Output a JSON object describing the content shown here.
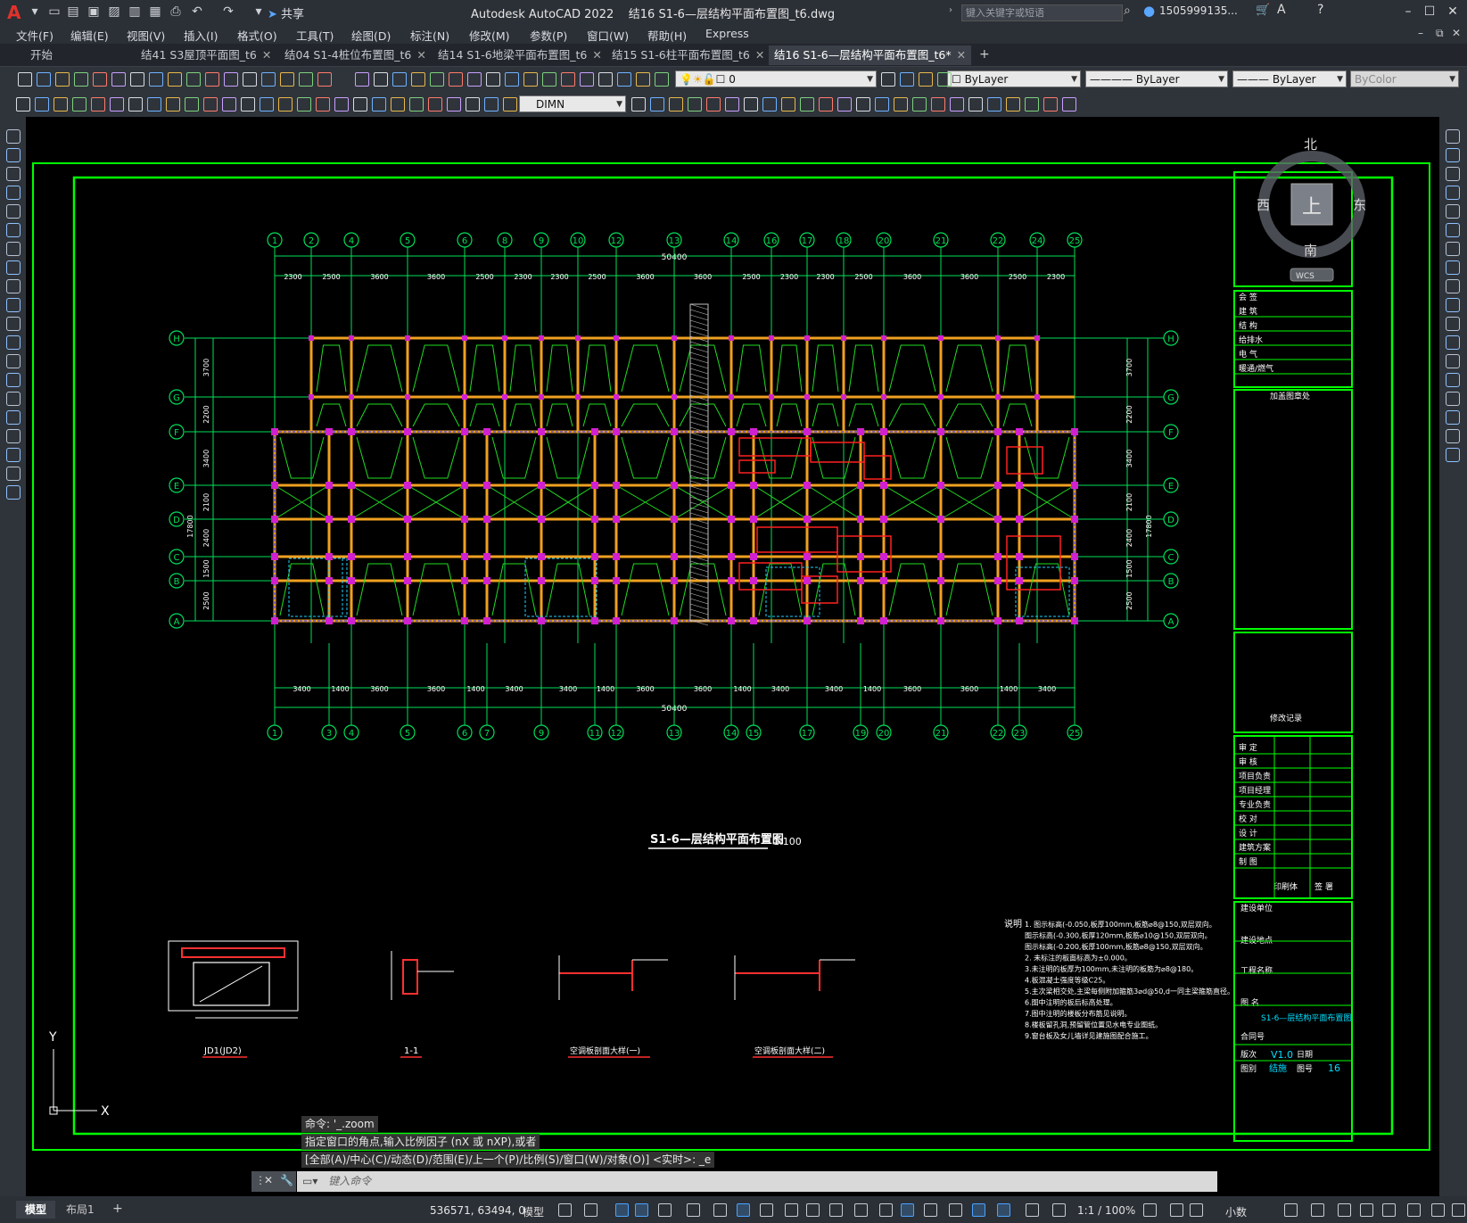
{
  "app": {
    "title": "Autodesk AutoCAD 2022",
    "file_title": "结16 S1-6—层结构平面布置图_t6.dwg",
    "share_label": "共享"
  },
  "search": {
    "placeholder": "键入关键字或短语"
  },
  "user": {
    "name": "1505999135..."
  },
  "menus": [
    "文件(F)",
    "编辑(E)",
    "视图(V)",
    "插入(I)",
    "格式(O)",
    "工具(T)",
    "绘图(D)",
    "标注(N)",
    "修改(M)",
    "参数(P)",
    "窗口(W)",
    "帮助(H)",
    "Express"
  ],
  "doc_tabs": [
    {
      "label": "开始",
      "closable": false
    },
    {
      "label": "结41 S3屋顶平面图_t6",
      "closable": true
    },
    {
      "label": "结04 S1-4桩位布置图_t6",
      "closable": true
    },
    {
      "label": "结14 S1-6地梁平面布置图_t6",
      "closable": true
    },
    {
      "label": "结15 S1-6柱平面布置图_t6",
      "closable": true
    },
    {
      "label": "结16 S1-6—层结构平面布置图_t6*",
      "closable": true,
      "active": true
    }
  ],
  "layer_combo": {
    "value": "0"
  },
  "color_combo": {
    "value": "ByLayer"
  },
  "linetype_combo": {
    "value": "ByLayer"
  },
  "lineweight_combo": {
    "value": "ByLayer"
  },
  "plotstyle_combo": {
    "value": "ByColor"
  },
  "dimstyle_combo": {
    "value": "DIMN"
  },
  "viewcube": {
    "north": "北",
    "south": "南",
    "east": "东",
    "west": "西",
    "top": "上",
    "wcs": "WCS"
  },
  "drawing": {
    "top_axes": [
      "1",
      "2",
      "4",
      "5",
      "6",
      "8",
      "9",
      "10",
      "12",
      "13",
      "14",
      "16",
      "17",
      "18",
      "20",
      "21",
      "22",
      "24",
      "25"
    ],
    "bottom_axes": [
      "1",
      "3",
      "4",
      "5",
      "6",
      "7",
      "9",
      "11",
      "12",
      "13",
      "14",
      "15",
      "17",
      "19",
      "20",
      "21",
      "22",
      "23",
      "25"
    ],
    "row_axes": [
      "H",
      "G",
      "F",
      "E",
      "D",
      "C",
      "B",
      "A"
    ],
    "top_dims": [
      "2300",
      "2500",
      "3600",
      "3600",
      "2500",
      "2300",
      "2300",
      "2500",
      "3600",
      "3600",
      "2500",
      "2300",
      "2300",
      "2500",
      "3600",
      "3600",
      "2500",
      "2300"
    ],
    "bottom_dims": [
      "3400",
      "1400",
      "3600",
      "3600",
      "1400",
      "3400",
      "3400",
      "1400",
      "3600",
      "3600",
      "1400",
      "3400",
      "3400",
      "1400",
      "3600",
      "3600",
      "1400",
      "3400"
    ],
    "total_dim": "50400",
    "left_dims": [
      "3700",
      "2200",
      "3400",
      "2100",
      "2400",
      "1500",
      "2500"
    ],
    "left_total": "17800",
    "drawing_title": "S1-6—层结构平面布置图",
    "drawing_scale": "1:100",
    "details": [
      "JD1(JD2)",
      "1-1",
      "空调板剖面大样(一)",
      "空调板剖面大样(二)"
    ],
    "notes_header": "说明",
    "notes": [
      "1.  图示标高(-0.050,板厚100mm,板筋⌀8@150,双层双向。",
      "    图示标高(-0.300,板厚120mm,板筋⌀10@150,双层双向。",
      "    图示标高(-0.200,板厚100mm,板筋⌀8@150,双层双向。",
      "2.  未标注的板面标高为±0.000。",
      "3.未注明的板厚为100mm,未注明的板筋为⌀8@180。",
      "4.板混凝土强度等级C25。",
      "5.主次梁相交处,主梁每侧附加箍筋3⌀d@50,d一同主梁箍筋直径。",
      "6.图中注明的板后标高处理。",
      "7.图中注明的楼板分布筋见说明。",
      "8.楼板留孔洞,预留管位置见水电专业图纸。",
      "9.窗台板及女儿墙详见建施图配合施工。"
    ]
  },
  "title_block": {
    "countersign": "会 签",
    "disciplines": [
      "建 筑",
      "结 构",
      "给排水",
      "电 气",
      "暖通/燃气"
    ],
    "stamp": "加盖图章处",
    "revision": "修改记录",
    "roles": [
      "审 定",
      "审 核",
      "项目负责",
      "项目经理",
      "专业负责",
      "校 对",
      "设 计",
      "建筑方案",
      "制 图"
    ],
    "print": "印刷体",
    "sign": "签 署",
    "client": "建设单位",
    "site": "建设地点",
    "project": "工程名称",
    "drawing_name_label": "图 名",
    "drawing_name": "S1-6—层结构平面布置图",
    "contract": "合同号",
    "version_label": "版次",
    "version": "V1.0",
    "date_label": "日期",
    "category_label": "图别",
    "category": "结施",
    "sheet_label": "图号",
    "sheet": "16"
  },
  "command_history": [
    "命令: '_.zoom",
    "指定窗口的角点,输入比例因子 (nX 或 nXP),或者",
    "[全部(A)/中心(C)/动态(D)/范围(E)/上一个(P)/比例(S)/窗口(W)/对象(O)] <实时>: _e"
  ],
  "command_input": {
    "placeholder": "键入命令"
  },
  "layout_tabs": [
    "模型",
    "布局1"
  ],
  "status": {
    "coords": "536571, 63494, 0",
    "model": "模型",
    "scale": "1:1 / 100%",
    "units": "小数"
  },
  "colors": {
    "canvas": "#000000",
    "frame": "#00ff00",
    "axis": "#00e05a",
    "beam": "#f0a020",
    "wall": "#ff2020",
    "accent": "#49a3ff"
  }
}
